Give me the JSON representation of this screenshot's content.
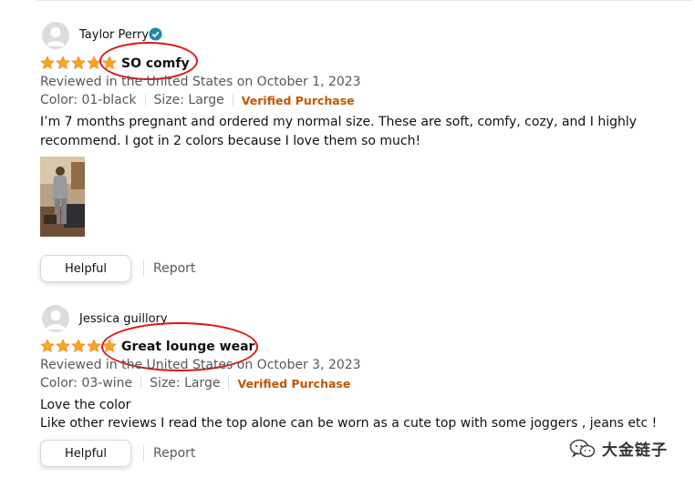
{
  "reviews": [
    {
      "reviewer": "Taylor Perry",
      "rating": 5,
      "title": "SO comfy",
      "reviewed_line": "Reviewed in the United States on October 1, 2023",
      "color": "Color: 01-black",
      "size": "Size: Large",
      "verified": "Verified Purchase",
      "body": "I’m 7 months pregnant and ordered my normal size. These are soft, comfy, cozy, and I highly recommend. I got in 2 colors because I love them so much!",
      "helpful_label": "Helpful",
      "report_label": "Report"
    },
    {
      "reviewer": "Jessica guillory",
      "rating": 5,
      "title": "Great lounge wear",
      "reviewed_line": "Reviewed in the United States on October 3, 2023",
      "color": "Color: 03-wine",
      "size": "Size: Large",
      "verified": "Verified Purchase",
      "body_line1": "Love the color",
      "body_line2": "Like other reviews I read the top alone can be worn as a cute top with some joggers , jeans etc !",
      "helpful_label": "Helpful",
      "report_label": "Report"
    }
  ],
  "watermark": {
    "text": "大金链子"
  },
  "colors": {
    "star": "#ffa41c",
    "verified": "#c45500",
    "annotation": "#e01414",
    "badge": "#1a8da7"
  }
}
